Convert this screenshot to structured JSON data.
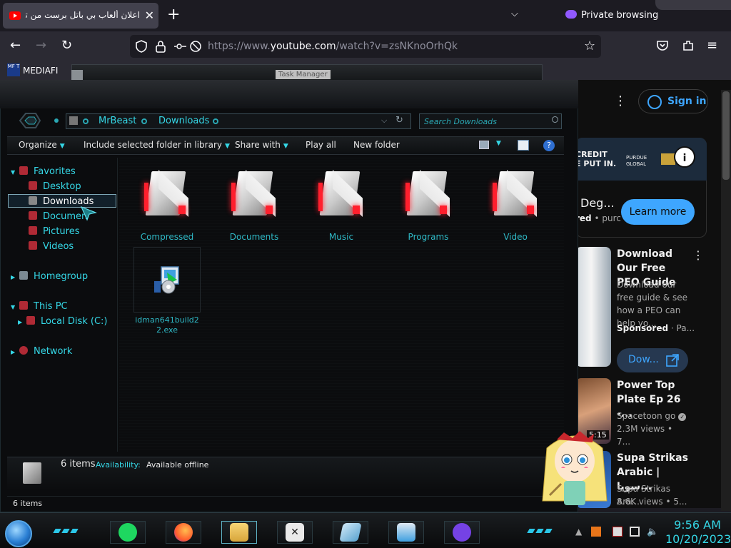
{
  "browser": {
    "tab_title": "اعلان ألعاب بي باتل برست من تيـ",
    "tab_close": "✕",
    "new_tab": "+",
    "tab_list": "⌵",
    "private_label": "Private browsing",
    "url_prefix": "https://www.",
    "url_host": "youtube.com",
    "url_path": "/watch?v=zsNKnoOrhQk",
    "back": "←",
    "forward": "→",
    "reload": "↻",
    "star": "☆",
    "menu": "≡",
    "bookmark": {
      "badge": "MF T",
      "label": "MEDIAFI"
    }
  },
  "youtube": {
    "more": "⋮",
    "sign_in": "Sign in",
    "ad": {
      "banner_text": "CREDIT\nE PUT IN.",
      "brand": "PURDUE GLOBAL",
      "info": "i",
      "headline": "Deg...",
      "advertiser_prefix": "red",
      "advertiser": "purc",
      "cta": "Learn more"
    },
    "videos": [
      {
        "title": "Download Our Free PEO Guide",
        "desc": "Download our free guide & see how a PEO can help yo...",
        "badge": "Sponsored",
        "badge_sep": "· Pa...",
        "cta": "Dow..."
      },
      {
        "title": "Power Top Plate Ep 26 -...",
        "channel": "Spacetoon go",
        "meta": "2.3M views • 7...",
        "duration": "5:15"
      },
      {
        "title": "Supa Strikas Arabic | سويا...",
        "channel": "Supa Strikas Ara...",
        "meta": "8.6K views • 5..."
      }
    ]
  },
  "explorer": {
    "task_manager_label": "Task Manager",
    "breadcrumb": [
      "MrBeast",
      "Downloads"
    ],
    "search_placeholder": "Search Downloads",
    "commands": [
      "Organize",
      "Include selected folder in library",
      "Share with",
      "Play all",
      "New folder"
    ],
    "help": "?",
    "nav": {
      "favorites": "Favorites",
      "desktop": "Desktop",
      "downloads": "Downloads",
      "documents": "Documen",
      "pictures": "Pictures",
      "videos": "Videos",
      "homegroup": "Homegroup",
      "this_pc": "This PC",
      "local_disk": "Local Disk (C:)",
      "network": "Network"
    },
    "folders": [
      "Compressed",
      "Documents",
      "Music",
      "Programs",
      "Video"
    ],
    "file": "idman641build22.exe",
    "details": {
      "count": "6 items",
      "availability_label": "Availability:",
      "availability_value": "Available offline"
    },
    "status": "6 items"
  },
  "taskbar": {
    "clock_time": "9:56 AM",
    "clock_date": "10/20/2023"
  },
  "colors": {
    "accent": "#35d7e6",
    "folder_glow": "#ff1f2d",
    "yt_blue": "#3ea6ff"
  }
}
